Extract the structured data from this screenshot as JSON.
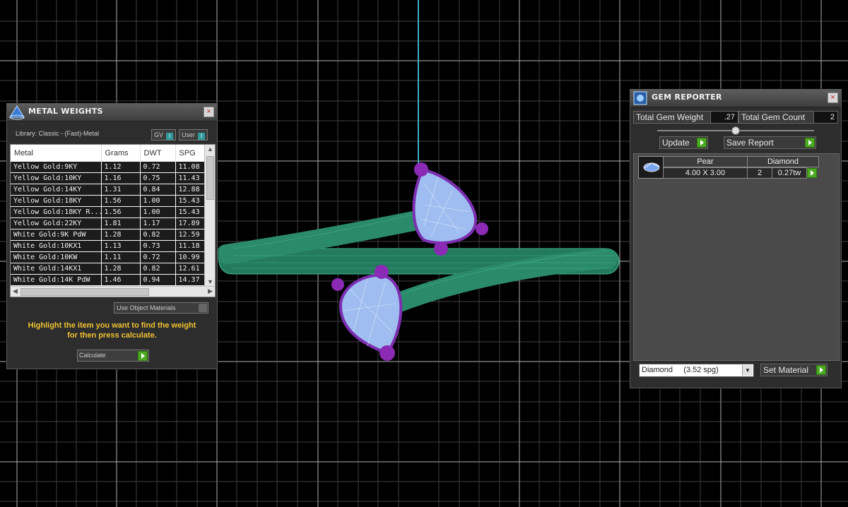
{
  "metal_weights": {
    "title": "METAL WEIGHTS",
    "library_label": "Library: Classic - (Fast)-Metal",
    "gv_label": "GV",
    "user_label": "User",
    "toggle_glyph": "I",
    "columns": [
      "Metal",
      "Grams",
      "DWT",
      "SPG"
    ],
    "rows": [
      [
        "Yellow Gold:9KY",
        "1.12",
        "0.72",
        "11.08"
      ],
      [
        "Yellow Gold:10KY",
        "1.16",
        "0.75",
        "11.43"
      ],
      [
        "Yellow Gold:14KY",
        "1.31",
        "0.84",
        "12.88"
      ],
      [
        "Yellow Gold:18KY",
        "1.56",
        "1.00",
        "15.43"
      ],
      [
        "Yellow Gold:18KY R...",
        "1.56",
        "1.00",
        "15.43"
      ],
      [
        "Yellow Gold:22KY",
        "1.81",
        "1.17",
        "17.89"
      ],
      [
        "White Gold:9K PdW",
        "1.28",
        "0.82",
        "12.59"
      ],
      [
        "White Gold:10KX1",
        "1.13",
        "0.73",
        "11.18"
      ],
      [
        "White Gold:10KW",
        "1.11",
        "0.72",
        "10.99"
      ],
      [
        "White Gold:14KX1",
        "1.28",
        "0.82",
        "12.61"
      ],
      [
        "White Gold:14K PdW",
        "1.46",
        "0.94",
        "14.37"
      ]
    ],
    "use_object_materials": "Use Object Materials",
    "hint_line1": "Highlight the item you want to find the weight",
    "hint_line2": "for then press calculate.",
    "calculate_label": "Calculate",
    "close_glyph": "×"
  },
  "gem_reporter": {
    "title": "GEM REPORTER",
    "total_weight_label": "Total Gem Weight",
    "total_weight_value": ".27",
    "total_count_label": "Total Gem Count",
    "total_count_value": "2",
    "update_label": "Update",
    "save_report_label": "Save Report",
    "gem": {
      "shape": "Pear",
      "size": "4.00 X 3.00",
      "material": "Diamond",
      "count": "2",
      "weight": "0.27tw"
    },
    "material_select": "Diamond     (3.52 spg)",
    "set_material_label": "Set Material",
    "close_glyph": "×"
  },
  "colors": {
    "band": "#2b8a6a",
    "gem": "#a7c4f2",
    "prong": "#9b2fc4",
    "grid": "#d8d8d8",
    "axis": "#3fb0c0",
    "hint": "#f0c232"
  },
  "icons": [
    "metal-weights-icon",
    "gem-reporter-icon",
    "close-icon",
    "pear-gem-icon",
    "dropdown-icon",
    "go-arrow-icon"
  ]
}
